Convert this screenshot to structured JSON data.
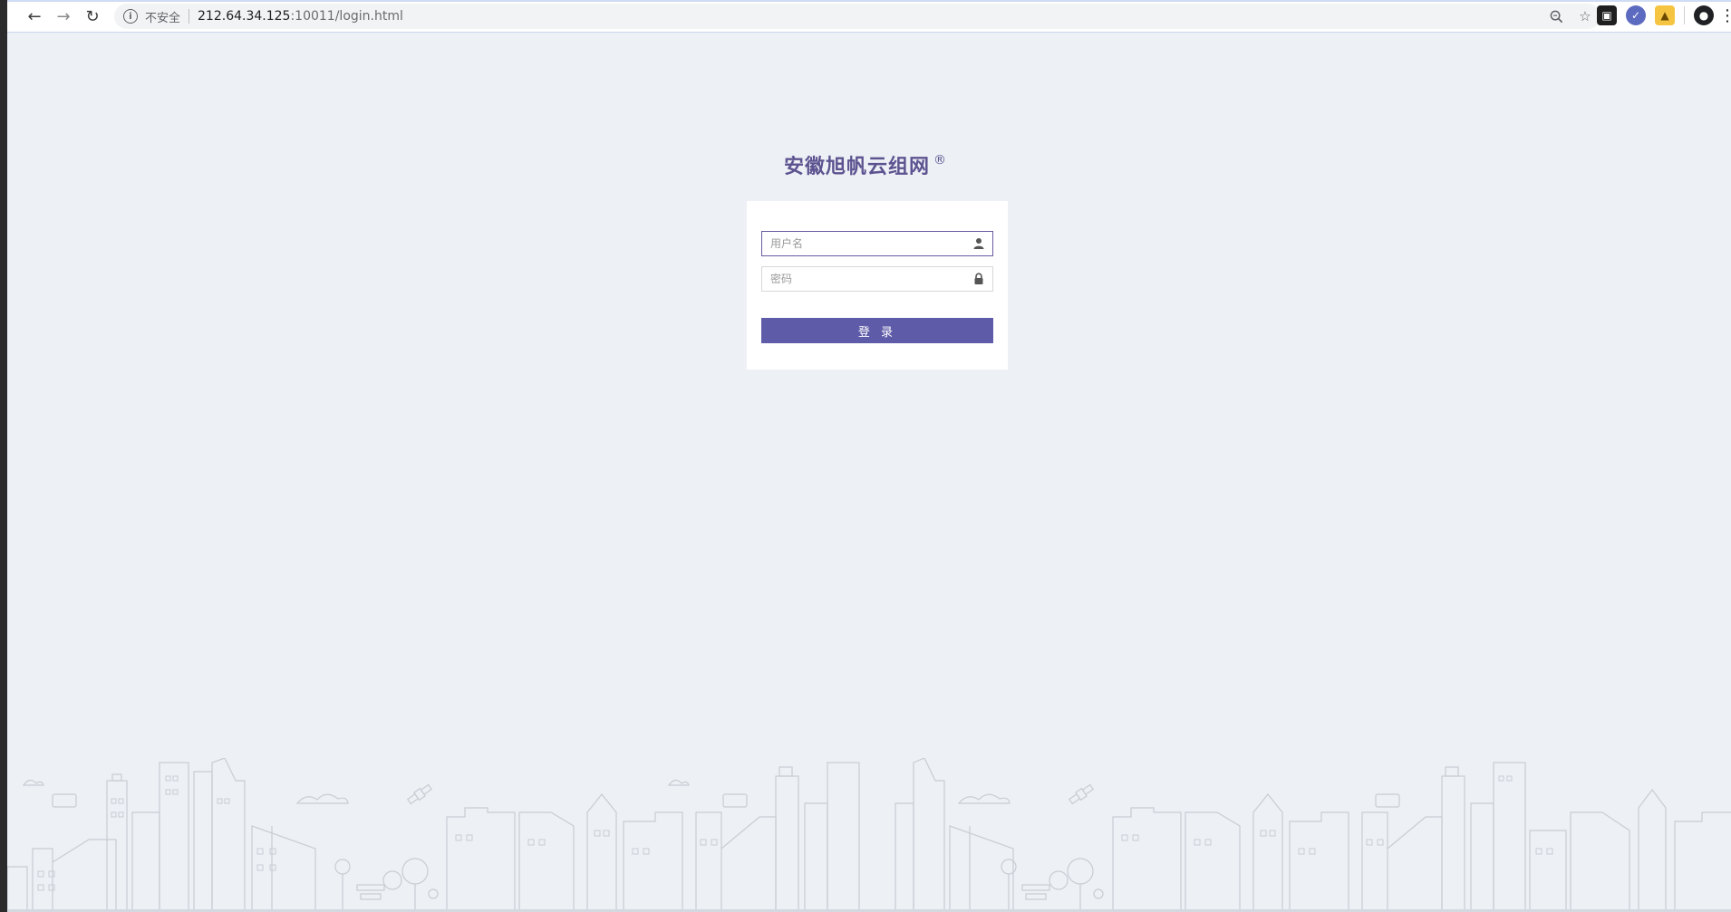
{
  "browser": {
    "security_label": "不安全",
    "url_host": "212.64.34.125",
    "url_rest": ":10011/login.html",
    "icons": {
      "back": "back-arrow-icon",
      "forward": "forward-arrow-icon",
      "reload": "reload-icon",
      "info": "info-icon",
      "zoom": "zoom-icon",
      "bookmark": "star-icon",
      "profile": "profile-icon",
      "menu": "kebab-menu-icon"
    }
  },
  "login": {
    "title": "安徽旭帆云组网",
    "registered_mark": "®",
    "username_placeholder": "用户名",
    "password_placeholder": "密码",
    "submit_label": "登 录"
  },
  "colors": {
    "accent": "#5e5ba8",
    "title": "#5c5390",
    "background": "#edf0f5",
    "skyline_stroke": "#c9ccd3"
  }
}
